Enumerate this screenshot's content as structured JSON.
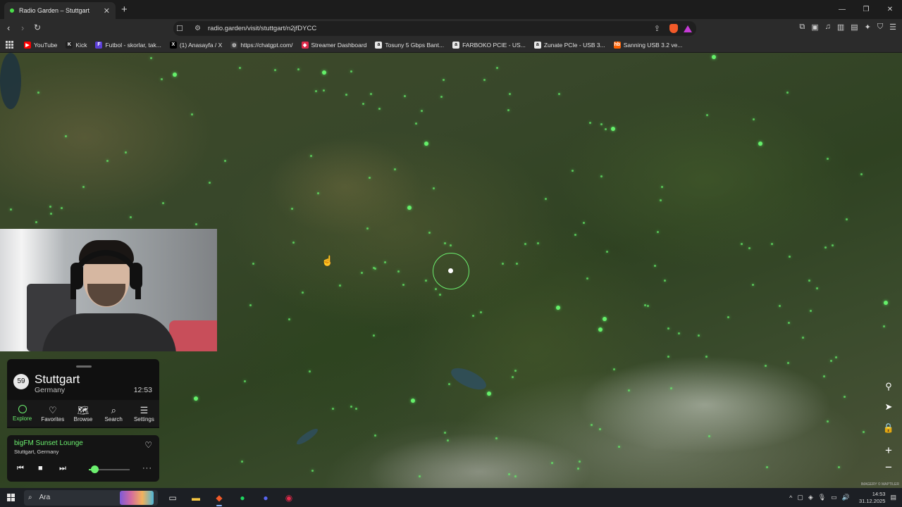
{
  "browser": {
    "tab_title": "Radio Garden – Stuttgart",
    "tab_close": "✕",
    "new_tab": "+",
    "url": "radio.garden/visit/stuttgart/n2jfDYCC",
    "window_controls": [
      "—",
      "❐",
      "✕"
    ],
    "bookmarks": [
      {
        "label": "YouTube",
        "icon": "youtube-icon",
        "color": "#ff0000",
        "glyph": "▶"
      },
      {
        "label": "Kick",
        "icon": "kick-icon",
        "color": "#1f1f1f",
        "glyph": "K"
      },
      {
        "label": "Futbol - skorlar, tak...",
        "icon": "futbol-icon",
        "color": "#5b3fd6",
        "glyph": "F"
      },
      {
        "label": "(1) Anasayfa / X",
        "icon": "x-icon",
        "color": "#000000",
        "glyph": "X"
      },
      {
        "label": "https://chatgpt.com/",
        "icon": "chatgpt-icon",
        "color": "#3a3a3a",
        "glyph": "◎"
      },
      {
        "label": "Streamer Dashboard",
        "icon": "streamer-icon",
        "color": "#e02a4a",
        "glyph": "◆"
      },
      {
        "label": "Tosuny 5 Gbps Bant...",
        "icon": "amazon-icon",
        "color": "#e8e8e8",
        "glyph": "a"
      },
      {
        "label": "FARBOKO PCIE - US...",
        "icon": "amazon-icon",
        "color": "#e8e8e8",
        "glyph": "a"
      },
      {
        "label": "Zunate PCIe - USB 3...",
        "icon": "amazon-icon",
        "color": "#e8e8e8",
        "glyph": "a"
      },
      {
        "label": "Sanning USB 3.2 ve...",
        "icon": "hb-icon",
        "color": "#ff6000",
        "glyph": "hb"
      }
    ]
  },
  "map": {
    "attribution": "IMAGERY © MAPTILER"
  },
  "location": {
    "station_count": "59",
    "city": "Stuttgart",
    "country": "Germany",
    "local_time": "12:53"
  },
  "nav_tabs": [
    {
      "label": "Explore",
      "icon": "explore-icon",
      "glyph": ""
    },
    {
      "label": "Favorites",
      "icon": "heart-icon",
      "glyph": "♡"
    },
    {
      "label": "Browse",
      "icon": "map-icon",
      "glyph": "🗺"
    },
    {
      "label": "Search",
      "icon": "search-icon",
      "glyph": "⌕"
    },
    {
      "label": "Settings",
      "icon": "menu-icon",
      "glyph": "☰"
    }
  ],
  "player": {
    "station": "bigFM Sunset Lounge",
    "station_location": "Stuttgart, Germany",
    "volume": 0.15
  },
  "taskbar": {
    "search_placeholder": "Ara",
    "time": "14:53",
    "date": "31.12.2025"
  }
}
